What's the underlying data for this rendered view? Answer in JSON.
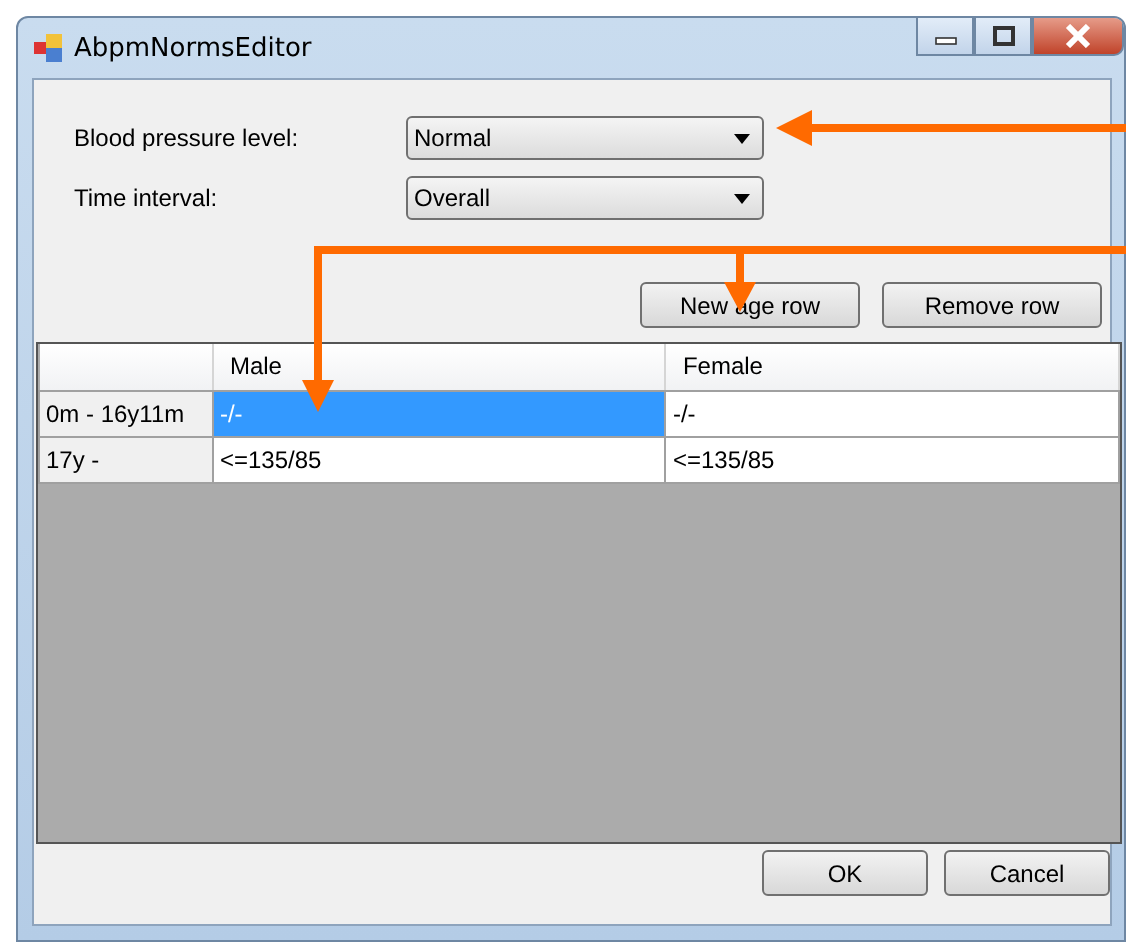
{
  "window": {
    "title": "AbpmNormsEditor"
  },
  "fields": [
    {
      "label": "Blood pressure level:",
      "value": "Normal"
    },
    {
      "label": "Time interval:",
      "value": "Overall"
    }
  ],
  "grid_buttons": [
    "New age row",
    "Remove row"
  ],
  "table": {
    "columns": [
      "Male",
      "Female"
    ],
    "rows": [
      {
        "header": "0m - 16y11m",
        "cells": [
          {
            "text": "-/-",
            "selected": true
          },
          {
            "text": "-/-",
            "selected": false
          }
        ]
      },
      {
        "header": "17y -",
        "cells": [
          {
            "text": "<=135/85",
            "selected": false
          },
          {
            "text": "<=135/85",
            "selected": false
          }
        ]
      }
    ]
  },
  "buttons": [
    "OK",
    "Cancel"
  ]
}
